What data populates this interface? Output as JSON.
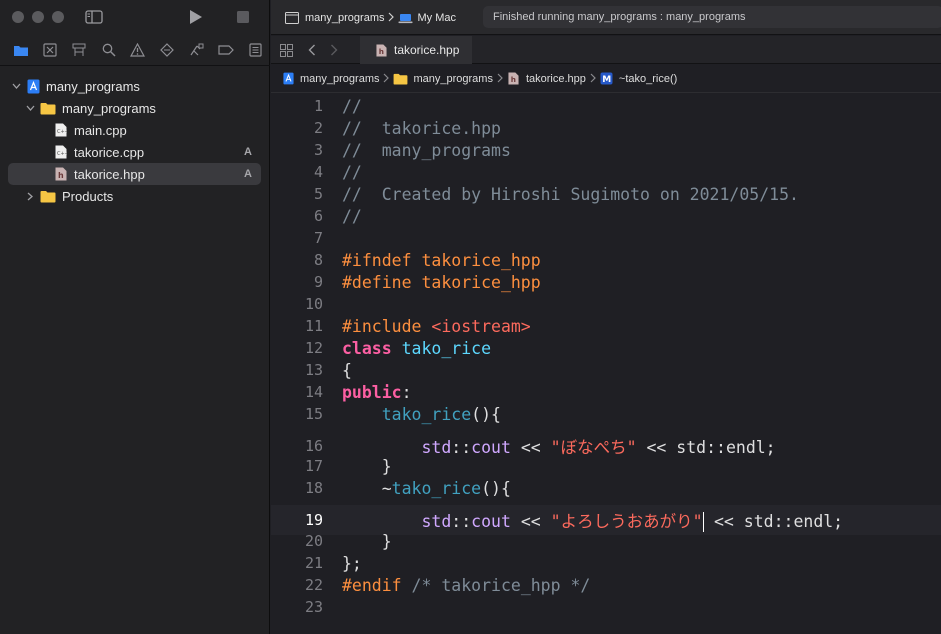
{
  "toolbar": {
    "scheme_target": "many_programs",
    "destination": "My Mac",
    "status": "Finished running many_programs : many_programs"
  },
  "navigator": {
    "tree": [
      {
        "label": "many_programs",
        "icon": "xcode-project-icon",
        "badge": ""
      },
      {
        "label": "many_programs",
        "icon": "folder-icon",
        "badge": ""
      },
      {
        "label": "main.cpp",
        "icon": "cpp-file-icon",
        "badge": ""
      },
      {
        "label": "takorice.cpp",
        "icon": "cpp-file-icon",
        "badge": "A"
      },
      {
        "label": "takorice.hpp",
        "icon": "header-file-icon",
        "badge": "A"
      },
      {
        "label": "Products",
        "icon": "folder-icon",
        "badge": ""
      }
    ]
  },
  "editor": {
    "tab": "takorice.hpp",
    "breadcrumb": [
      "many_programs",
      "many_programs",
      "takorice.hpp",
      "~tako_rice()"
    ],
    "lines": [
      {
        "n": "1",
        "segs": [
          [
            "cm",
            "//"
          ]
        ]
      },
      {
        "n": "2",
        "segs": [
          [
            "cm",
            "//  takorice.hpp"
          ]
        ]
      },
      {
        "n": "3",
        "segs": [
          [
            "cm",
            "//  many_programs"
          ]
        ]
      },
      {
        "n": "4",
        "segs": [
          [
            "cm",
            "//"
          ]
        ]
      },
      {
        "n": "5",
        "segs": [
          [
            "cm",
            "//  Created by Hiroshi Sugimoto on 2021/05/15."
          ]
        ]
      },
      {
        "n": "6",
        "segs": [
          [
            "cm",
            "//"
          ]
        ]
      },
      {
        "n": "7",
        "segs": []
      },
      {
        "n": "8",
        "segs": [
          [
            "pp",
            "#ifndef takorice_hpp"
          ]
        ]
      },
      {
        "n": "9",
        "segs": [
          [
            "pp",
            "#define takorice_hpp"
          ]
        ]
      },
      {
        "n": "10",
        "segs": []
      },
      {
        "n": "11",
        "segs": [
          [
            "pp",
            "#include "
          ],
          [
            "str",
            "<iostream>"
          ]
        ]
      },
      {
        "n": "12",
        "segs": [
          [
            "kw",
            "class"
          ],
          [
            "",
            " "
          ],
          [
            "ty",
            "tako_rice"
          ]
        ]
      },
      {
        "n": "13",
        "segs": [
          [
            "",
            "{"
          ]
        ]
      },
      {
        "n": "14",
        "segs": [
          [
            "kw",
            "public"
          ],
          [
            "",
            ":"
          ]
        ]
      },
      {
        "n": "15",
        "segs": [
          [
            "",
            "    "
          ],
          [
            "fn",
            "tako_rice"
          ],
          [
            "",
            "(){"
          ]
        ]
      },
      {
        "n": "16",
        "segs": [
          [
            "",
            "        "
          ],
          [
            "cls",
            "std"
          ],
          [
            "",
            "::"
          ],
          [
            "cls",
            "cout"
          ],
          [
            "",
            " << "
          ],
          [
            "str",
            "\"ぼなぺち\""
          ],
          [
            "",
            " << std::endl;"
          ]
        ]
      },
      {
        "n": "17",
        "segs": [
          [
            "",
            "    }"
          ]
        ]
      },
      {
        "n": "18",
        "segs": [
          [
            "",
            "    ~"
          ],
          [
            "fn",
            "tako_rice"
          ],
          [
            "",
            "(){"
          ]
        ]
      },
      {
        "n": "19",
        "segs": [
          [
            "",
            "        "
          ],
          [
            "cls",
            "std"
          ],
          [
            "",
            "::"
          ],
          [
            "cls",
            "cout"
          ],
          [
            "",
            " << "
          ],
          [
            "str",
            "\"よろしうおあがり\""
          ],
          [
            "cursor",
            ""
          ],
          [
            "",
            " << std::endl;"
          ]
        ]
      },
      {
        "n": "20",
        "segs": [
          [
            "",
            "    }"
          ]
        ]
      },
      {
        "n": "21",
        "segs": [
          [
            "",
            "};"
          ]
        ]
      },
      {
        "n": "22",
        "segs": [
          [
            "pp",
            "#endif"
          ],
          [
            "cm",
            " /* takorice_hpp */"
          ]
        ]
      },
      {
        "n": "23",
        "segs": []
      }
    ],
    "current_line": "19"
  }
}
